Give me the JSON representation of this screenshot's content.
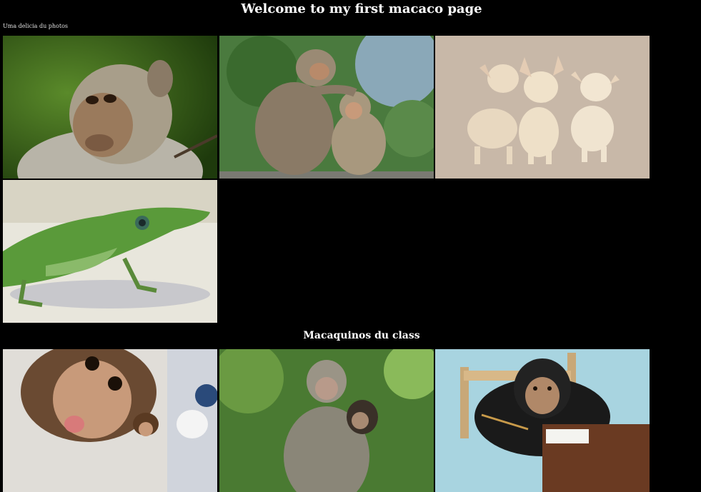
{
  "header": {
    "title": "Welcome to my first macaco page",
    "subtitle": "Uma delicia du photos"
  },
  "gallery_top": [
    {
      "subject": "young-macaque-portrait"
    },
    {
      "subject": "macaque-grooming-baby"
    },
    {
      "subject": "three-chihuahuas"
    },
    {
      "subject": "green-anole-lizard"
    }
  ],
  "section": {
    "heading": "Macaquinos du class"
  },
  "gallery_bottom": [
    {
      "subject": "baby-monkey-selfie"
    },
    {
      "subject": "macaque-holding-baby"
    },
    {
      "subject": "chimpanzee-writing-at-desk"
    }
  ]
}
